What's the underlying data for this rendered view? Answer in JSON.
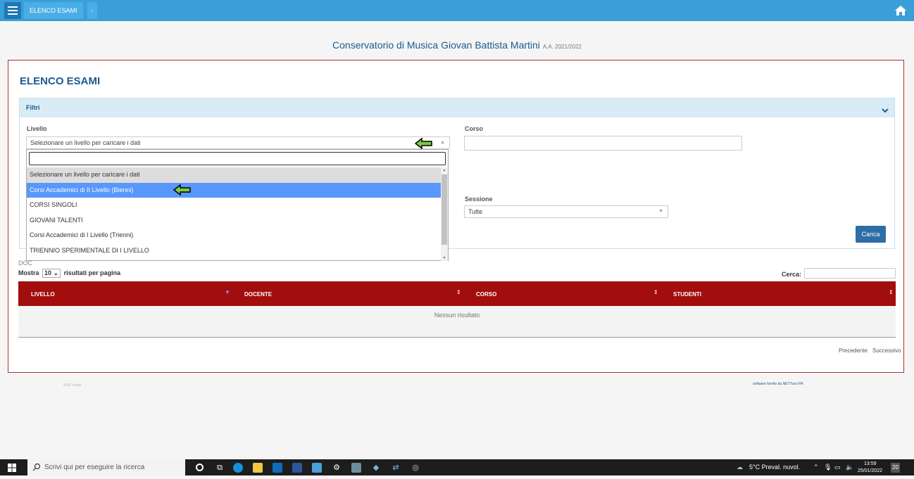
{
  "topbar": {
    "breadcrumb": "ELENCO ESAMI",
    "sep": "-"
  },
  "header": {
    "org_name": "Conservatorio di Musica Giovan Battista Martini",
    "academic_year": "A.A. 2021/2022"
  },
  "page": {
    "title": "ELENCO ESAMI"
  },
  "filters": {
    "title": "Filtri",
    "livello_label": "Livello",
    "livello_value": "Selezionare un livello per caricare i dati",
    "corso_label": "Corso",
    "sessione_label": "Sessione",
    "sessione_value": "Tutte",
    "carica_label": "Carica"
  },
  "dropdown": {
    "options": [
      "Selezionare un livello per caricare i dati",
      "Corsi Accademici di II Livello (Bienni)",
      "CORSI SINGOLI",
      "GIOVANI TALENTI",
      "Corsi Accademici di I Livello (Trienni)",
      "TRIENNIO SPERIMENTALE DI I LIVELLO"
    ],
    "highlighted_index": 1
  },
  "table_controls": {
    "doc_label": "DOC",
    "show_prefix": "Mostra",
    "page_size": "10",
    "show_suffix": "risultati per pagina",
    "search_label": "Cerca:"
  },
  "table": {
    "columns": [
      "LIVELLO",
      "DOCENTE",
      "CORSO",
      "STUDENTI"
    ],
    "empty_message": "Nessun risultato"
  },
  "pagination": {
    "prev": "Precedente",
    "next": "Successivo"
  },
  "footer": {
    "left": "W3C valido",
    "right": "software fornito da NETTuno PA"
  },
  "taskbar": {
    "search_placeholder": "Scrivi qui per eseguire la ricerca",
    "weather": "5°C Preval. nuvol.",
    "time": "13:59",
    "date": "25/01/2022",
    "notifications": "20"
  },
  "colors": {
    "topbar": "#3a9fd9",
    "header_row": "#a20d0d",
    "highlight": "#5897fb",
    "accent": "#1c5a8f"
  }
}
